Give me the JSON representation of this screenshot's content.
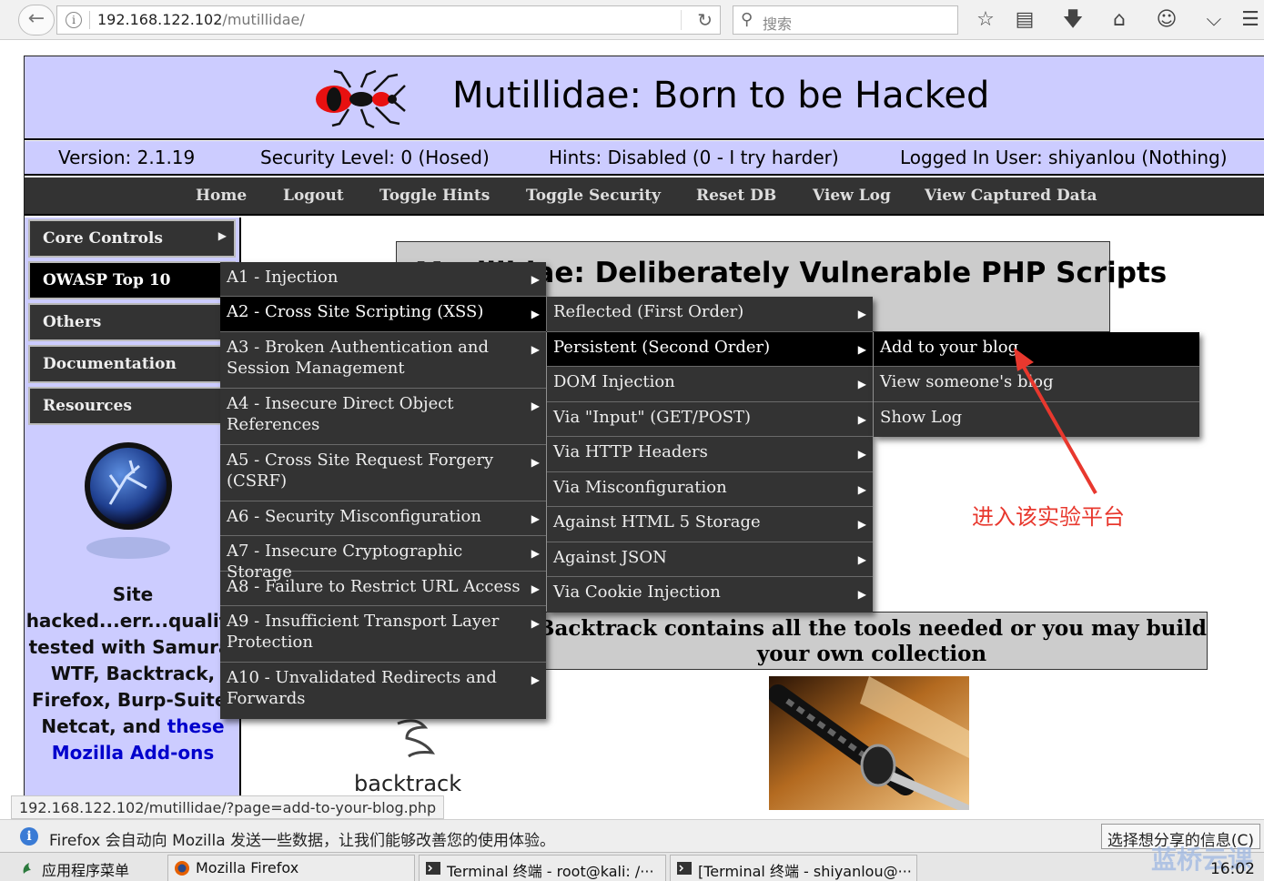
{
  "browser": {
    "url_host": "192.168.122.102",
    "url_path": "/mutillidae/",
    "search_placeholder": "搜索",
    "status_url": "192.168.122.102/mutillidae/?page=add-to-your-blog.php",
    "notification": "Firefox 会自动向 Mozilla 发送一些数据，让我们能够改善您的使用体验。",
    "share_button": "选择想分享的信息(C)",
    "icons": [
      "back-icon",
      "info-icon",
      "reload-icon",
      "search-icon",
      "bookmark-star-icon",
      "reading-list-icon",
      "download-icon",
      "home-icon",
      "chat-icon",
      "pocket-icon",
      "menu-icon"
    ]
  },
  "site": {
    "title": "Mutillidae: Born to be Hacked",
    "version": "Version: 2.1.19",
    "security": "Security Level: 0 (Hosed)",
    "hints": "Hints: Disabled (0 - I try harder)",
    "user": "Logged In User: shiyanlou (Nothing)",
    "nav": [
      "Home",
      "Logout",
      "Toggle Hints",
      "Toggle Security",
      "Reset DB",
      "View Log",
      "View Captured Data"
    ]
  },
  "left_menu": [
    "Core Controls",
    "OWASP Top 10",
    "Others",
    "Documentation",
    "Resources"
  ],
  "sidebar_text": {
    "line1": "Site",
    "line2": "hacked...err...quality",
    "line3": "tested with Samurai",
    "line4": "WTF, Backtrack,",
    "line5": "Firefox, Burp-Suite,",
    "line6": "Netcat, and",
    "link1": "these",
    "link2": "Mozilla Add-ons"
  },
  "content": {
    "title": "Mutillidae: Deliberately Vulnerable PHP Scripts",
    "backtrack_line1": "Backtrack contains all the tools needed or you may build",
    "backtrack_line2": "your own collection",
    "backtrack_label": "backtrack"
  },
  "owasp_menu": [
    "A1 - Injection",
    "A2 - Cross Site Scripting (XSS)",
    "A3 - Broken Authentication and Session Management",
    "A4 - Insecure Direct Object References",
    "A5 - Cross Site Request Forgery (CSRF)",
    "A6 - Security Misconfiguration",
    "A7 - Insecure Cryptographic Storage",
    "A8 - Failure to Restrict URL Access",
    "A9 - Insufficient Transport Layer Protection",
    "A10 - Unvalidated Redirects and Forwards"
  ],
  "xss_menu": [
    "Reflected (First Order)",
    "Persistent (Second Order)",
    "DOM Injection",
    "Via \"Input\" (GET/POST)",
    "Via HTTP Headers",
    "Via Misconfiguration",
    "Against HTML 5 Storage",
    "Against JSON",
    "Via Cookie Injection"
  ],
  "persistent_menu": [
    "Add to your blog",
    "View someone's blog",
    "Show Log"
  ],
  "annotation": "进入该实验平台",
  "taskbar": {
    "apps_menu": "应用程序菜单",
    "task1": "Mozilla Firefox",
    "task2": "Terminal 终端 - root@kali: /···",
    "task3": "[Terminal 终端 - shiyanlou@···",
    "clock": "16:02",
    "watermark": "蓝桥云课"
  }
}
